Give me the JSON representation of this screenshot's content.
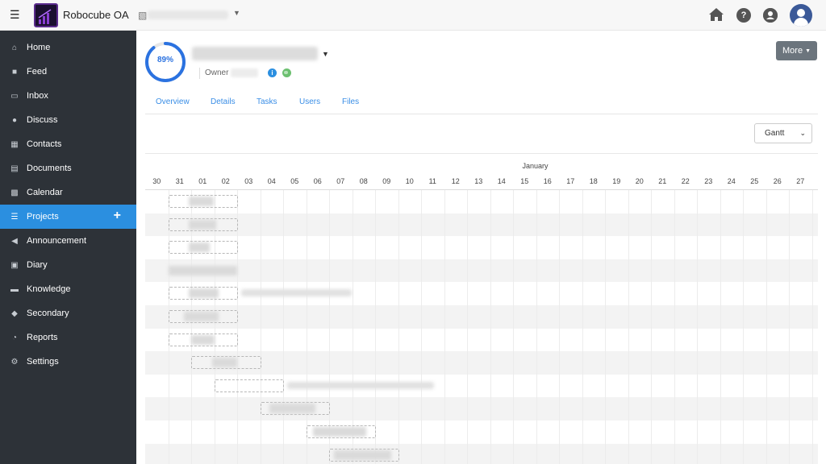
{
  "header": {
    "app_title": "Robocube OA",
    "org_icon": "building-icon",
    "menu_icon": "hamburger-icon",
    "right_icons": [
      "home-icon",
      "help-icon",
      "user-circle-icon",
      "avatar"
    ]
  },
  "sidebar": {
    "items": [
      {
        "label": "Home",
        "icon": "home-icon"
      },
      {
        "label": "Feed",
        "icon": "comment-icon"
      },
      {
        "label": "Inbox",
        "icon": "inbox-icon"
      },
      {
        "label": "Discuss",
        "icon": "chat-icon"
      },
      {
        "label": "Contacts",
        "icon": "address-book-icon"
      },
      {
        "label": "Documents",
        "icon": "document-icon"
      },
      {
        "label": "Calendar",
        "icon": "calendar-icon"
      },
      {
        "label": "Projects",
        "icon": "list-icon",
        "active": true,
        "action": "+"
      },
      {
        "label": "Announcement",
        "icon": "megaphone-icon"
      },
      {
        "label": "Diary",
        "icon": "book-icon"
      },
      {
        "label": "Knowledge",
        "icon": "database-icon"
      },
      {
        "label": "Secondary",
        "icon": "tags-icon"
      },
      {
        "label": "Reports",
        "icon": "pie-chart-icon"
      },
      {
        "label": "Settings",
        "icon": "gears-icon"
      }
    ]
  },
  "project": {
    "progress": "89%",
    "progress_value": 0.89,
    "owner_label": "Owner",
    "more_label": "More"
  },
  "tabs": [
    "Overview",
    "Details",
    "Tasks",
    "Users",
    "Files"
  ],
  "view_select": {
    "value": "Gantt"
  },
  "gantt": {
    "month": "January",
    "days": [
      "30",
      "31",
      "01",
      "02",
      "03",
      "04",
      "05",
      "06",
      "07",
      "08",
      "09",
      "10",
      "11",
      "12",
      "13",
      "14",
      "15",
      "16",
      "17",
      "18",
      "19",
      "20",
      "21",
      "22",
      "23",
      "24",
      "25",
      "26",
      "27"
    ]
  },
  "colors": {
    "sidebar_bg": "#2d3238",
    "active": "#2b8fe0",
    "link": "#3a8ee6",
    "button": "#6c757d"
  }
}
